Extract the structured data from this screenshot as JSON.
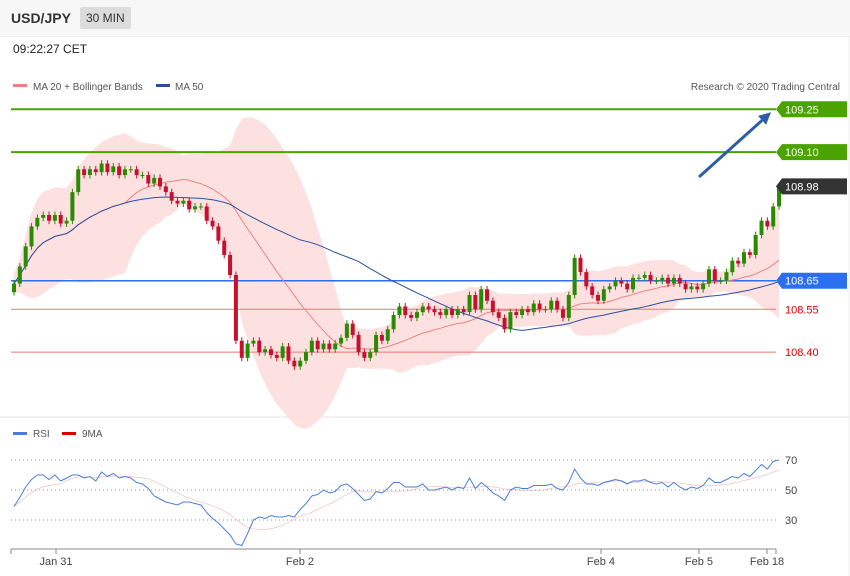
{
  "header": {
    "symbol": "USD/JPY",
    "timeframe": "30 MIN",
    "time": "09:22:27 CET"
  },
  "legend": {
    "ma20": "MA 20 + Bollinger Bands",
    "ma50": "MA 50",
    "copyright": "Research © 2020 Trading Central"
  },
  "rsi_legend": {
    "rsi": "RSI",
    "ma9": "9MA"
  },
  "colors": {
    "up": "#2a8a00",
    "down": "#c8102e",
    "ma50": "#2a4fa0",
    "band": "#fddcdc",
    "resistance": "#4aa300",
    "pivot": "#2b6ff0",
    "support": "#e87878",
    "arrow": "#2d5ca8"
  },
  "chart_data": [
    {
      "type": "candlestick",
      "ylim": [
        108.25,
        109.3
      ],
      "x_ticks": [
        "Jan 31",
        "Feb 2",
        "Feb 4",
        "Feb 5",
        "Feb 18"
      ],
      "levels": [
        {
          "value": 109.25,
          "label": "109.25",
          "kind": "resistance"
        },
        {
          "value": 109.1,
          "label": "109.10",
          "kind": "resistance"
        },
        {
          "value": 108.98,
          "label": "108.98",
          "kind": "last"
        },
        {
          "value": 108.65,
          "label": "108.65",
          "kind": "pivot"
        },
        {
          "value": 108.55,
          "label": "108.55",
          "kind": "support"
        },
        {
          "value": 108.4,
          "label": "108.40",
          "kind": "support"
        }
      ],
      "close": [
        108.64,
        108.7,
        108.77,
        108.84,
        108.87,
        108.88,
        108.86,
        108.88,
        108.85,
        108.86,
        108.96,
        109.04,
        109.02,
        109.04,
        109.03,
        109.06,
        109.03,
        109.05,
        109.02,
        109.04,
        109.04,
        109.02,
        109.02,
        108.99,
        109.01,
        108.98,
        108.96,
        108.93,
        108.92,
        108.93,
        108.9,
        108.91,
        108.91,
        108.86,
        108.84,
        108.79,
        108.74,
        108.67,
        108.44,
        108.38,
        108.43,
        108.44,
        108.4,
        108.41,
        108.39,
        108.38,
        108.42,
        108.37,
        108.35,
        108.37,
        108.4,
        108.44,
        108.41,
        108.43,
        108.41,
        108.43,
        108.45,
        108.5,
        108.46,
        108.4,
        108.38,
        108.4,
        108.46,
        108.44,
        108.48,
        108.53,
        108.56,
        108.53,
        108.52,
        108.54,
        108.56,
        108.55,
        108.54,
        108.53,
        108.55,
        108.53,
        108.55,
        108.54,
        108.6,
        108.55,
        108.62,
        108.58,
        108.54,
        108.52,
        108.48,
        108.54,
        108.53,
        108.55,
        108.54,
        108.57,
        108.55,
        108.55,
        108.58,
        108.55,
        108.52,
        108.6,
        108.73,
        108.68,
        108.63,
        108.6,
        108.58,
        108.62,
        108.63,
        108.65,
        108.64,
        108.62,
        108.66,
        108.66,
        108.67,
        108.65,
        108.65,
        108.66,
        108.64,
        108.66,
        108.64,
        108.62,
        108.63,
        108.62,
        108.64,
        108.69,
        108.65,
        108.65,
        108.68,
        108.72,
        108.71,
        108.75,
        108.74,
        108.81,
        108.86,
        108.84,
        108.91,
        108.98
      ],
      "rsi": [
        39,
        45,
        52,
        57,
        60,
        60,
        57,
        60,
        56,
        58,
        60,
        60,
        58,
        59,
        56,
        62,
        59,
        61,
        58,
        59,
        58,
        55,
        54,
        51,
        46,
        44,
        42,
        41,
        40,
        42,
        42,
        41,
        40,
        35,
        31,
        28,
        24,
        20,
        14,
        13,
        21,
        30,
        32,
        31,
        33,
        32,
        32,
        33,
        32,
        37,
        41,
        46,
        47,
        50,
        48,
        49,
        53,
        54,
        51,
        47,
        43,
        44,
        49,
        48,
        51,
        55,
        55,
        52,
        52,
        52,
        54,
        50,
        50,
        51,
        52,
        50,
        52,
        51,
        58,
        51,
        55,
        52,
        48,
        46,
        43,
        50,
        52,
        51,
        51,
        53,
        53,
        53,
        54,
        51,
        50,
        55,
        64,
        58,
        54,
        54,
        53,
        55,
        56,
        57,
        56,
        54,
        56,
        56,
        57,
        55,
        54,
        55,
        52,
        55,
        52,
        50,
        52,
        51,
        53,
        58,
        55,
        55,
        57,
        59,
        58,
        61,
        59,
        63,
        67,
        64,
        69,
        70
      ],
      "rsi_levels": [
        70,
        50,
        30
      ]
    }
  ]
}
